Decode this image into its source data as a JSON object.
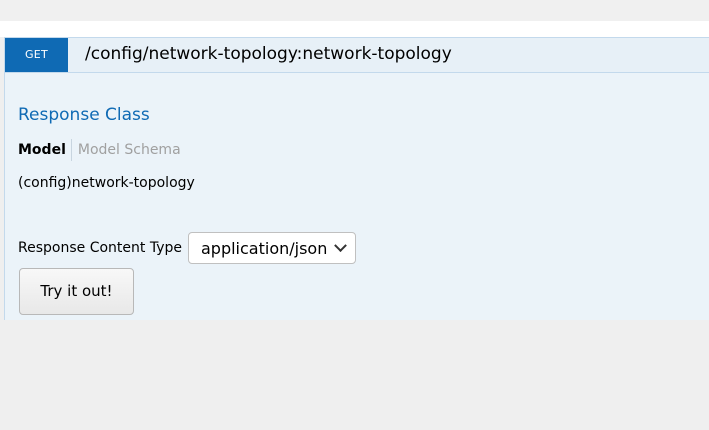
{
  "operation": {
    "method": "GET",
    "path": "/config/network-topology:network-topology"
  },
  "response_class": {
    "title": "Response Class",
    "tabs": [
      {
        "label": "Model",
        "active": true
      },
      {
        "label": "Model Schema",
        "active": false
      }
    ],
    "model_signature": "(config)network-topology"
  },
  "content_type": {
    "label": "Response Content Type",
    "selected": "application/json"
  },
  "actions": {
    "try_label": "Try it out!"
  },
  "colors": {
    "method_get": "#0f6ab4",
    "panel_bg": "#ebf3f9",
    "link_blue": "#0f6ab4"
  },
  "icons": {
    "select_arrow": "chevron-down-icon"
  }
}
